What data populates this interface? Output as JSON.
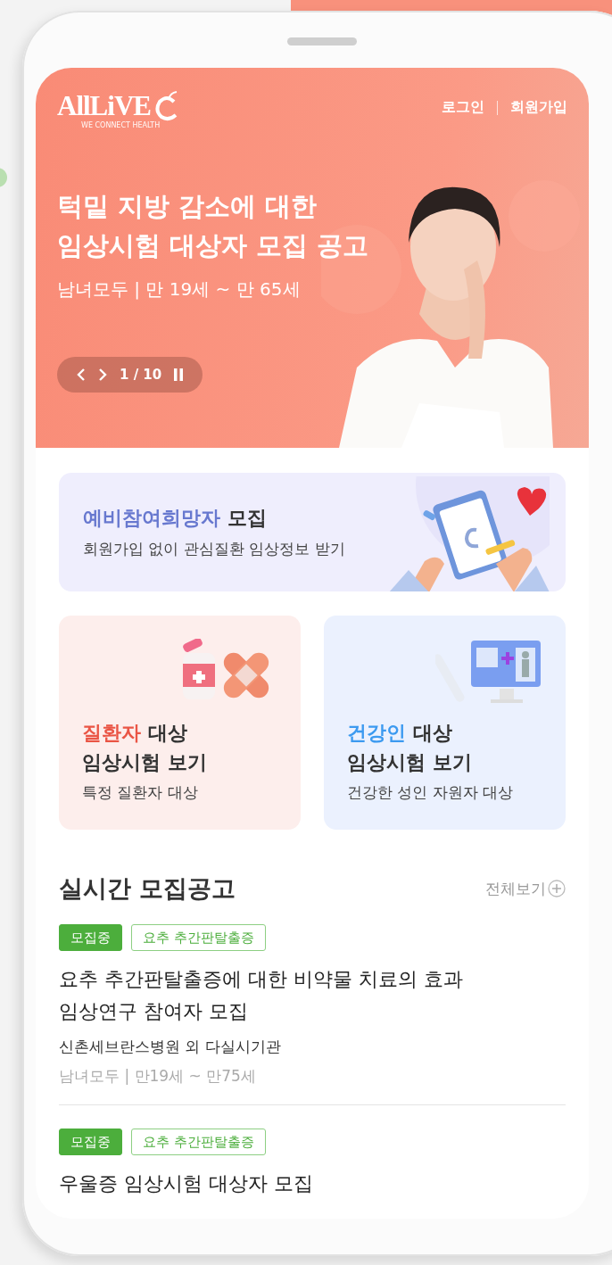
{
  "header": {
    "logo": "AllLiVE",
    "logo_tagline": "WE CONNECT HEALTH",
    "links": [
      "로그인",
      "회원가입"
    ]
  },
  "hero": {
    "title_lines": [
      "턱밑 지방 감소에 대한",
      "임상시험 대상자 모집 공고"
    ],
    "subtitle": "남녀모두 | 만 19세 ~ 만 65세",
    "pager": "1 / 10",
    "kind": "picture"
  },
  "banner": {
    "highlight": "예비참여희망자",
    "title_rest": "모집",
    "description": "회원가입 없이 관심질환 임상정보 받기"
  },
  "cards": [
    {
      "highlight": "질환자",
      "title_rest": "대상",
      "title_line2": "임상시험 보기",
      "description": "특정 질환자 대상",
      "kind": "patient"
    },
    {
      "highlight": "건강인",
      "title_rest": "대상",
      "title_line2": "임상시험 보기",
      "description": "건강한 성인 자원자 대상",
      "kind": "healthy"
    }
  ],
  "section": {
    "title": "실시간 모집공고",
    "more": "전체보기"
  },
  "listings": [
    {
      "tags": [
        {
          "label": "모집중",
          "kind": "status"
        },
        {
          "label": "요추 추간판탈출증",
          "kind": "condition"
        }
      ],
      "title_lines": [
        "요추 추간판탈출증에 대한 비약물 치료의 효과",
        "임상연구 참여자 모집"
      ],
      "institution": "신촌세브란스병원 외 다실시기관",
      "meta": "남녀모두 | 만19세 ~ 만75세"
    },
    {
      "tags": [
        {
          "label": "모집중",
          "kind": "status"
        },
        {
          "label": "요추 추간판탈출증",
          "kind": "condition"
        }
      ],
      "title_lines": [
        "우울증 임상시험 대상자 모집"
      ]
    }
  ]
}
